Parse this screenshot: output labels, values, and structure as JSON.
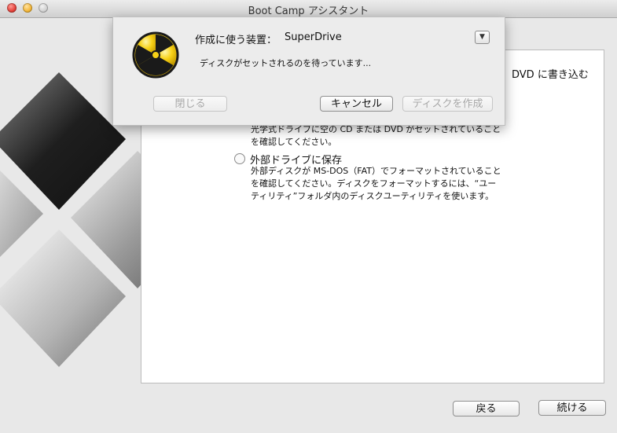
{
  "window": {
    "title": "Boot Camp アシスタント"
  },
  "sheet": {
    "device_label": "作成に使う装置：",
    "device_value": "SuperDrive",
    "dropdown_glyph": "▼",
    "status": "ディスクがセットされるのを待っています...",
    "close_label": "閉じる",
    "cancel_label": "キャンセル",
    "create_label": "ディスクを作成",
    "icon": "burn-icon"
  },
  "main": {
    "partial_text": "DVD に書き込む",
    "option_external": {
      "label": "外部ドライブに保存",
      "desc_line1": "外部ディスクが MS-DOS（FAT）でフォーマットされていること",
      "desc_line2": "を確認してください。ディスクをフォーマットするには、“ユー",
      "desc_line3": "ティリティ”フォルダ内のディスクユーティリティを使います。"
    },
    "option_cd_desc": {
      "line1": "光学式ドライブに空の CD または DVD がセットされていること",
      "line2": "を確認してください。"
    }
  },
  "footer": {
    "back_label": "戻る",
    "continue_label": "続ける"
  },
  "colors": {
    "burn_yellow": "#f7d117",
    "burn_black": "#1a1a1a"
  }
}
